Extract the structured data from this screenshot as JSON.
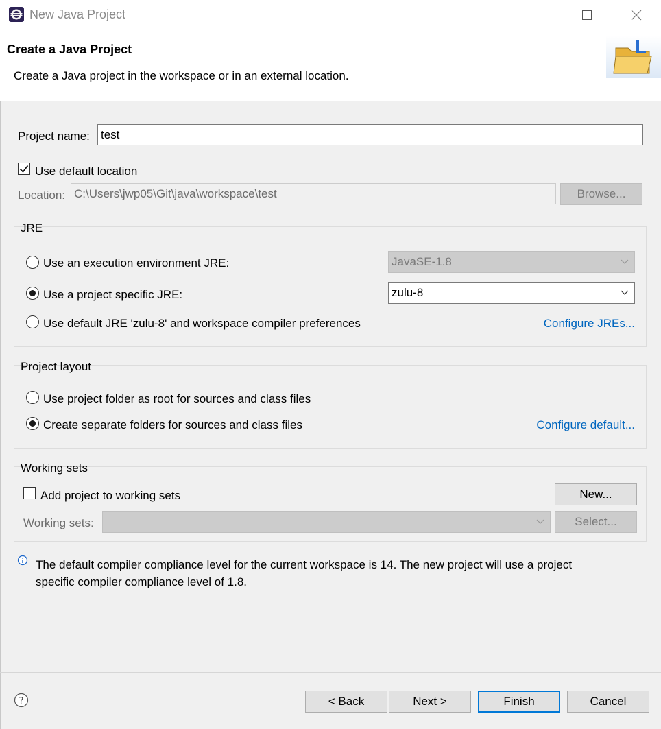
{
  "window": {
    "title": "New Java Project",
    "maximize_icon": "maximize-icon",
    "close_icon": "close-icon"
  },
  "header": {
    "title": "Create a Java Project",
    "description": "Create a Java project in the workspace or in an external location."
  },
  "project_name": {
    "label": "Project name:",
    "value": "test"
  },
  "location": {
    "use_default_label": "Use default location",
    "use_default_checked": true,
    "label": "Location:",
    "value": "C:\\Users\\jwp05\\Git\\java\\workspace\\test",
    "browse_label": "Browse..."
  },
  "jre": {
    "group_label": "JRE",
    "option_env_label": "Use an execution environment JRE:",
    "option_env_value": "JavaSE-1.8",
    "option_specific_label": "Use a project specific JRE:",
    "option_specific_value": "zulu-8",
    "option_default_label": "Use default JRE 'zulu-8' and workspace compiler preferences",
    "configure_link": "Configure JREs...",
    "selected": "specific"
  },
  "layout": {
    "group_label": "Project layout",
    "option_root_label": "Use project folder as root for sources and class files",
    "option_separate_label": "Create separate folders for sources and class files",
    "configure_link": "Configure default...",
    "selected": "separate"
  },
  "working_sets": {
    "group_label": "Working sets",
    "add_label": "Add project to working sets",
    "add_checked": false,
    "new_button": "New...",
    "sets_label": "Working sets:",
    "sets_value": "",
    "select_button": "Select..."
  },
  "info": {
    "icon": "info-icon",
    "line1": "The default compiler compliance level for the current workspace is 14. The new project will use a project",
    "line2": "specific compiler compliance level of 1.8."
  },
  "footer": {
    "help_icon": "help-icon",
    "back_label": "< Back",
    "next_label": "Next >",
    "finish_label": "Finish",
    "cancel_label": "Cancel"
  },
  "colors": {
    "link": "#0066bf",
    "default_button_border": "#0078d7",
    "dialog_background": "#f0f0f0"
  }
}
